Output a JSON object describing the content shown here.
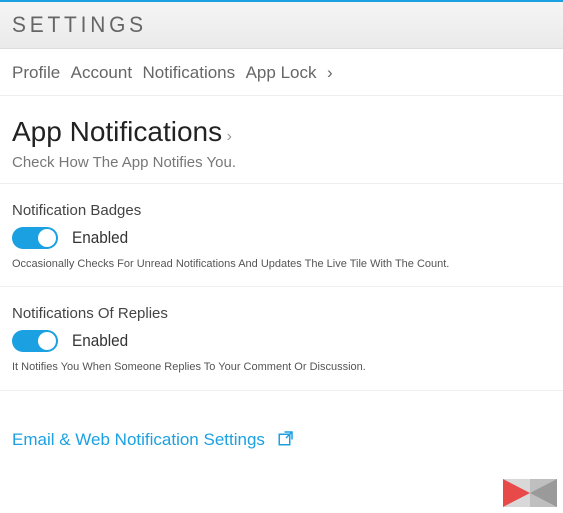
{
  "header": {
    "title": "SETTINGS"
  },
  "breadcrumb": {
    "items": [
      "Profile",
      "Account",
      "Notifications",
      "App Lock"
    ]
  },
  "section": {
    "title": "App Notifications",
    "subtitle": "Check How The App Notifies You."
  },
  "settings": {
    "badges": {
      "label": "Notification Badges",
      "state": "Enabled",
      "description": "Occasionally Checks For Unread Notifications And Updates The Live Tile With The Count."
    },
    "replies": {
      "label": "Notifications Of Replies",
      "state": "Enabled",
      "description": "It Notifies You When Someone Replies To Your Comment Or Discussion."
    }
  },
  "link": {
    "label": "Email & Web Notification Settings"
  },
  "colors": {
    "accent": "#1ba1e2"
  }
}
